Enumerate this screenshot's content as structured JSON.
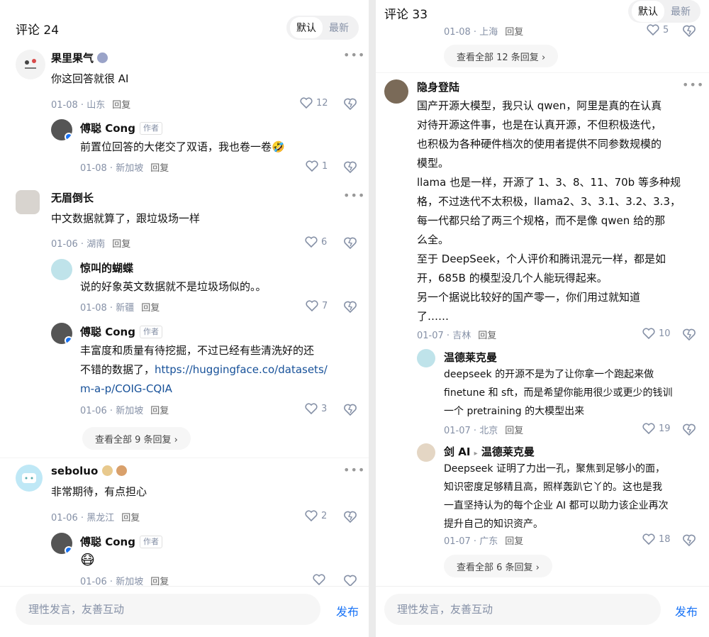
{
  "left": {
    "title": "评论 24",
    "sort": [
      "默认",
      "最新"
    ],
    "comments": [
      {
        "name": "果里果气",
        "text": "你这回答就很 AI",
        "date": "01-08",
        "loc": "山东",
        "reply": "回复",
        "likes": "12"
      },
      {
        "name": "傅聪 Cong",
        "badge": "作者",
        "text": "前置位回答的大佬交了双语，我也卷一卷🤣",
        "date": "01-08",
        "loc": "新加坡",
        "reply": "回复",
        "likes": "1"
      },
      {
        "name": "无眉倒长",
        "text": "中文数据就算了，跟垃圾场一样",
        "date": "01-06",
        "loc": "湖南",
        "reply": "回复",
        "likes": "6"
      },
      {
        "name": "惊叫的蝴蝶",
        "text": "说的好象英文数据就不是垃圾场似的。。",
        "date": "01-08",
        "loc": "新疆",
        "reply": "回复",
        "likes": "7"
      },
      {
        "name": "傅聪 Cong",
        "badge": "作者",
        "text_l1": "丰富度和质量有待挖掘，不过已经有些清洗好的还",
        "text_l2a": "不错的数据了，",
        "link_a": "https://huggingface.co/datasets/",
        "link_b": "m-a-p/COIG-CQIA",
        "date": "01-06",
        "loc": "新加坡",
        "reply": "回复",
        "likes": "3"
      },
      {
        "name": "seboluo",
        "text": "非常期待，有点担心",
        "date": "01-06",
        "loc": "黑龙江",
        "reply": "回复",
        "likes": "2"
      },
      {
        "name": "傅聪 Cong",
        "badge": "作者",
        "text": "😷",
        "date": "01-06",
        "loc": "新加坡",
        "reply": "回复",
        "likes": ""
      }
    ],
    "view_all": "查看全部 9 条回复 ›",
    "input_placeholder": "理性发言，友善互动",
    "send": "发布"
  },
  "right": {
    "title": "评论 33",
    "sort": [
      "默认",
      "最新"
    ],
    "top_meta": {
      "date": "01-08",
      "loc": "上海",
      "reply": "回复",
      "likes": "5"
    },
    "view_all_1": "查看全部 12 条回复 ›",
    "c1": {
      "name": "隐身登陆",
      "lines": [
        "国产开源大模型，我只认 qwen，阿里是真的在认真",
        "对待开源这件事，也是在认真开源，不但积极迭代，",
        "也积极为各种硬件档次的使用者提供不同参数规模的",
        "模型。",
        "llama 也是一样，开源了 1、3、8、11、70b 等多种规",
        "格，不过迭代不太积极，llama2、3、3.1、3.2、3.3，",
        "每一代都只给了两三个规格，而不是像 qwen 给的那",
        "么全。",
        "至于 DeepSeek，个人评价和腾讯混元一样，都是如",
        "开，685B 的模型没几个人能玩得起来。",
        "另一个据说比较好的国产零一，你们用过就知道",
        "了……"
      ],
      "date": "01-07",
      "loc": "吉林",
      "reply": "回复",
      "likes": "10"
    },
    "c2": {
      "name": "温德莱克曼",
      "lines": [
        "deepseek 的开源不是为了让你拿一个跑起来做",
        "finetune 和 sft，而是希望你能用很少或更少的钱训",
        "一个 pretraining 的大模型出来"
      ],
      "date": "01-07",
      "loc": "北京",
      "reply": "回复",
      "likes": "19"
    },
    "c3": {
      "name": "剑 AI",
      "reply_to": "温德莱克曼",
      "lines": [
        "Deepseek 证明了力出一孔，聚焦到足够小的面，",
        "知识密度足够精且高，照样轰趴它丫的。这也是我",
        "一直坚持认为的每个企业 AI 都可以助力该企业再次",
        "提升自己的知识资产。"
      ],
      "date": "01-07",
      "loc": "广东",
      "reply": "回复",
      "likes": "18"
    },
    "view_all_2": "查看全部 6 条回复 ›",
    "input_placeholder": "理性发言，友善互动",
    "send": "发布"
  },
  "colors": {
    "accent": "#1772f6",
    "meta": "#8590a6",
    "link": "#175199"
  }
}
